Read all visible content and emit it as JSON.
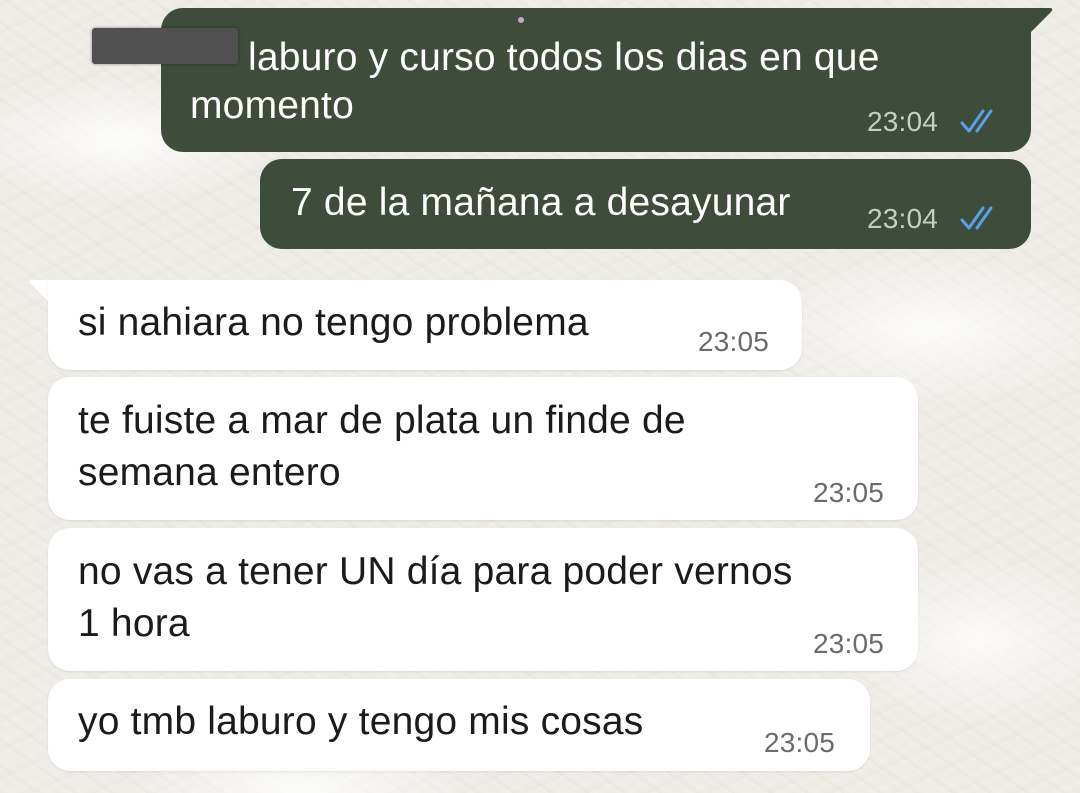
{
  "conversation": {
    "messages": [
      {
        "direction": "outgoing",
        "lines": [
          "laburo y curso todos los dias en que",
          "momento"
        ],
        "time": "23:04",
        "status": "read",
        "status_icon": "double-check-icon",
        "status_color": "#5aa0e8"
      },
      {
        "direction": "outgoing",
        "lines": [
          "7 de la mañana a desayunar"
        ],
        "time": "23:04",
        "status": "read",
        "status_icon": "double-check-icon",
        "status_color": "#5aa0e8"
      },
      {
        "direction": "incoming",
        "lines": [
          "si nahiara no tengo problema"
        ],
        "time": "23:05"
      },
      {
        "direction": "incoming",
        "lines": [
          "te fuiste a mar de plata un finde de",
          "semana entero"
        ],
        "time": "23:05"
      },
      {
        "direction": "incoming",
        "lines": [
          "no vas a tener UN día para poder vernos",
          "1 hora"
        ],
        "time": "23:05"
      },
      {
        "direction": "incoming",
        "lines": [
          "yo tmb laburo y tengo mis cosas"
        ],
        "time": "23:05"
      }
    ]
  },
  "colors": {
    "outgoing_bubble": "#3d4d3a",
    "incoming_bubble": "#ffffff",
    "read_ticks": "#5aa0e8"
  }
}
